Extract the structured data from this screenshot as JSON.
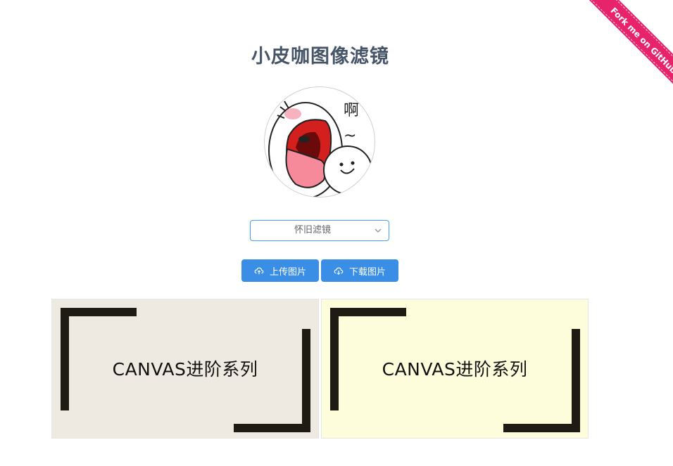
{
  "page": {
    "title": "小皮咖图像滤镜"
  },
  "ribbon": {
    "label": "Fork me on GitHub",
    "color": "#e6236b"
  },
  "avatar": {
    "caption_text": "啊",
    "tilde": "~"
  },
  "filter_select": {
    "selected": "怀旧滤镜",
    "icon": "chevron-down-icon"
  },
  "buttons": {
    "upload_label": "上传图片",
    "upload_icon": "upload-cloud-icon",
    "download_label": "下载图片",
    "download_icon": "download-cloud-icon",
    "color": "#3a8ee6"
  },
  "canvases": {
    "original": {
      "text": "CANVAS进阶系列",
      "background": "#eeeae2"
    },
    "filtered": {
      "text": "CANVAS进阶系列",
      "background": "#fdfddc"
    }
  }
}
